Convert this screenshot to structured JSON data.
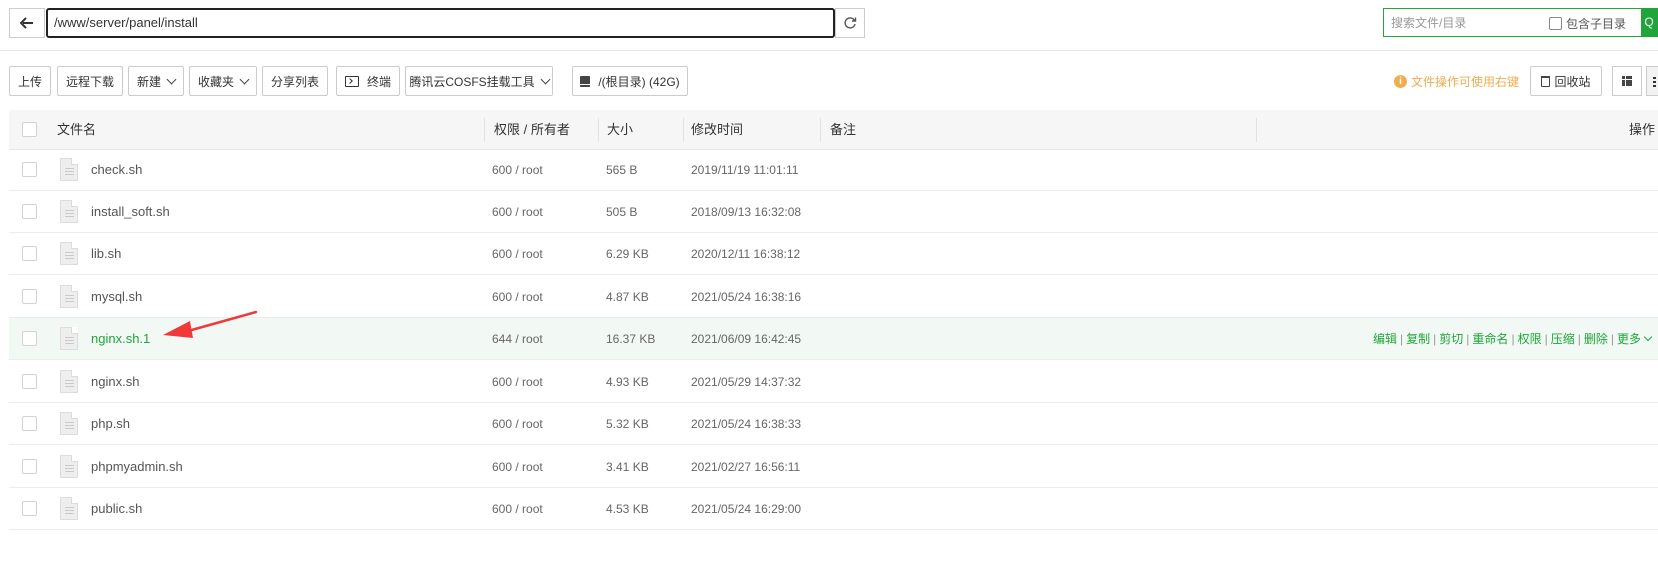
{
  "address": {
    "path": "/www/server/panel/install"
  },
  "search": {
    "placeholder": "搜索文件/目录",
    "include_subdir": "包含子目录",
    "button": "Q"
  },
  "toolbar": {
    "upload": "上传",
    "remote_download": "远程下载",
    "new": "新建",
    "favorites": "收藏夹",
    "share_list": "分享列表",
    "terminal": "终端",
    "cosfs": "腾讯云COSFS挂载工具",
    "disk": "/(根目录) (42G)",
    "tip": "文件操作可使用右键",
    "recycle": "回收站"
  },
  "table": {
    "headers": {
      "name": "文件名",
      "perm": "权限 / 所有者",
      "size": "大小",
      "mtime": "修改时间",
      "note": "备注",
      "ops": "操作"
    },
    "rows": [
      {
        "name": "check.sh",
        "perm": "600 / root",
        "size": "565 B",
        "mtime": "2019/11/19 11:01:11"
      },
      {
        "name": "install_soft.sh",
        "perm": "600 / root",
        "size": "505 B",
        "mtime": "2018/09/13 16:32:08"
      },
      {
        "name": "lib.sh",
        "perm": "600 / root",
        "size": "6.29 KB",
        "mtime": "2020/12/11 16:38:12"
      },
      {
        "name": "mysql.sh",
        "perm": "600 / root",
        "size": "4.87 KB",
        "mtime": "2021/05/24 16:38:16"
      },
      {
        "name": "nginx.sh.1",
        "perm": "644 / root",
        "size": "16.37 KB",
        "mtime": "2021/06/09 16:42:45",
        "highlighted": true
      },
      {
        "name": "nginx.sh",
        "perm": "600 / root",
        "size": "4.93 KB",
        "mtime": "2021/05/29 14:37:32"
      },
      {
        "name": "php.sh",
        "perm": "600 / root",
        "size": "5.32 KB",
        "mtime": "2021/05/24 16:38:33"
      },
      {
        "name": "phpmyadmin.sh",
        "perm": "600 / root",
        "size": "3.41 KB",
        "mtime": "2021/02/27 16:56:11"
      },
      {
        "name": "public.sh",
        "perm": "600 / root",
        "size": "4.53 KB",
        "mtime": "2021/05/24 16:29:00"
      }
    ],
    "row_actions": [
      "编辑",
      "复制",
      "剪切",
      "重命名",
      "权限",
      "压缩",
      "删除",
      "更多"
    ]
  },
  "colors": {
    "accent": "#20a53a",
    "tip": "#f0ad4e",
    "annotation_arrow": "#f03a3a"
  }
}
